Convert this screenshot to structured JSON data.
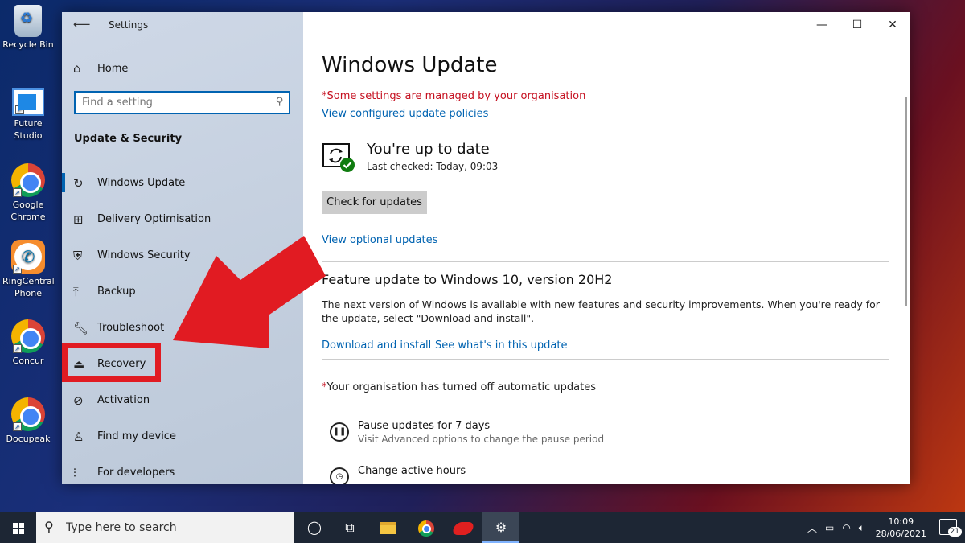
{
  "desktop": {
    "icons": [
      {
        "label": "Recycle Bin"
      },
      {
        "label": "Future Studio"
      },
      {
        "label": "Google Chrome"
      },
      {
        "label": "RingCentral Phone"
      },
      {
        "label": "Concur"
      },
      {
        "label": "Docupeak"
      }
    ]
  },
  "window": {
    "app_title": "Settings",
    "controls": {
      "minimize": "—",
      "maximize": "☐",
      "close": "✕"
    }
  },
  "sidebar": {
    "home_label": "Home",
    "search_placeholder": "Find a setting",
    "section_title": "Update & Security",
    "items": [
      {
        "label": "Windows Update",
        "icon": "sync-icon",
        "active": true
      },
      {
        "label": "Delivery Optimisation",
        "icon": "delivery-icon"
      },
      {
        "label": "Windows Security",
        "icon": "shield-icon"
      },
      {
        "label": "Backup",
        "icon": "backup-icon"
      },
      {
        "label": "Troubleshoot",
        "icon": "wrench-icon"
      },
      {
        "label": "Recovery",
        "icon": "recovery-icon"
      },
      {
        "label": "Activation",
        "icon": "check-circle-icon"
      },
      {
        "label": "Find my device",
        "icon": "person-pin-icon"
      },
      {
        "label": "For developers",
        "icon": "sliders-icon"
      }
    ]
  },
  "main": {
    "title": "Windows Update",
    "managed_notice": "*Some settings are managed by your organisation",
    "policies_link": "View configured update policies",
    "status_title": "You're up to date",
    "status_sub": "Last checked: Today, 09:03",
    "check_button": "Check for updates",
    "optional_link": "View optional updates",
    "feature_title": "Feature update to Windows 10, version 20H2",
    "feature_desc": "The next version of Windows is available with new features and security improvements. When you're ready for the update, select \"Download and install\".",
    "download_link": "Download and install",
    "see_link": "See what's in this update",
    "auto_off_star": "*",
    "auto_off": "Your organisation has turned off automatic updates",
    "options": [
      {
        "title": "Pause updates for 7 days",
        "sub": "Visit Advanced options to change the pause period"
      },
      {
        "title": "Change active hours",
        "sub": ""
      }
    ]
  },
  "taskbar": {
    "search_placeholder": "Type here to search",
    "time": "10:09",
    "date": "28/06/2021",
    "notification_count": "21"
  },
  "colors": {
    "accent": "#0063b1",
    "warning_red": "#c50f1f",
    "annotation_red": "#e11b22",
    "taskbar": "#1d2634"
  }
}
